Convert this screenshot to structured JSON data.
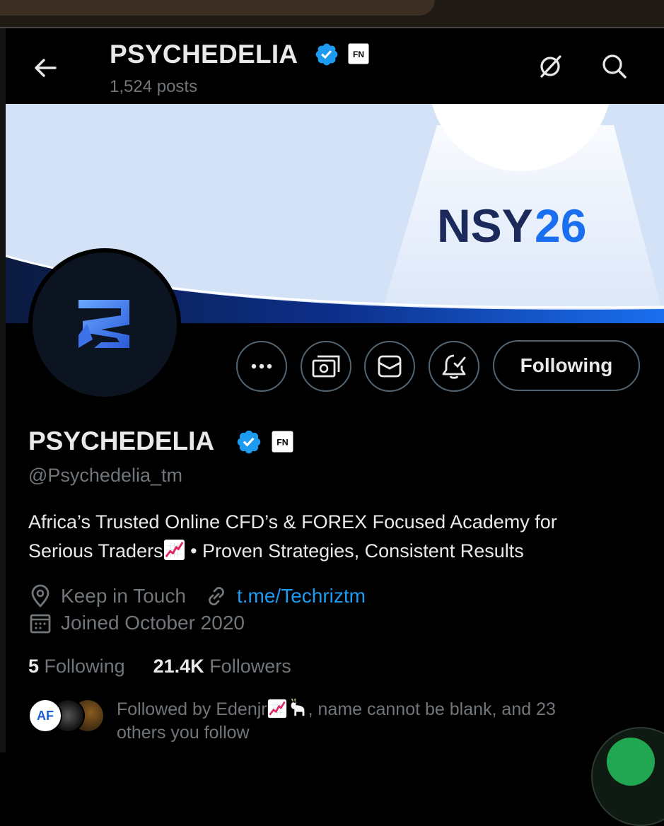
{
  "header": {
    "title": "PSYCHEDELIA",
    "posts_count": "1,524 posts",
    "badge_text": "FN"
  },
  "banner": {
    "logo_text": "NSY",
    "logo_year": "26",
    "colors": {
      "sky": "#d4e2f7",
      "navy": "#1b2a5a",
      "accent_blue": "#1a6ff0"
    }
  },
  "actions": {
    "following_label": "Following"
  },
  "profile": {
    "name": "PSYCHEDELIA",
    "handle": "@Psychedelia_tm",
    "badge_text": "FN",
    "bio_line1": "Africa’s Trusted Online CFD’s & FOREX Focused Academy for",
    "bio_line2_a": "Serious Traders",
    "bio_line2_b": " • Proven Strategies, Consistent Results",
    "location": "Keep in Touch",
    "website": "t.me/Techriztm",
    "joined": "Joined October 2020"
  },
  "stats": {
    "following_count": "5",
    "following_label": "Following",
    "followers_count": "21.4K",
    "followers_label": "Followers"
  },
  "followed_by": {
    "text_line1": "Followed by Edenjr",
    "text_line1_rest": ", name cannot be blank, and 23",
    "text_line2": "others you follow",
    "avatar1_text": "AF"
  },
  "theme": {
    "background": "#000000",
    "text_primary": "#e7e9ea",
    "text_secondary": "#71767b",
    "link": "#1d9bf0",
    "verified": "#1d9bf0",
    "border": "#536471"
  },
  "icons": [
    "back-arrow-icon",
    "grok-icon",
    "search-icon",
    "verified-icon",
    "more-icon",
    "subscribe-icon",
    "message-icon",
    "notification-icon",
    "location-icon",
    "link-icon",
    "calendar-icon",
    "chart-up-emoji",
    "goat-emoji"
  ]
}
